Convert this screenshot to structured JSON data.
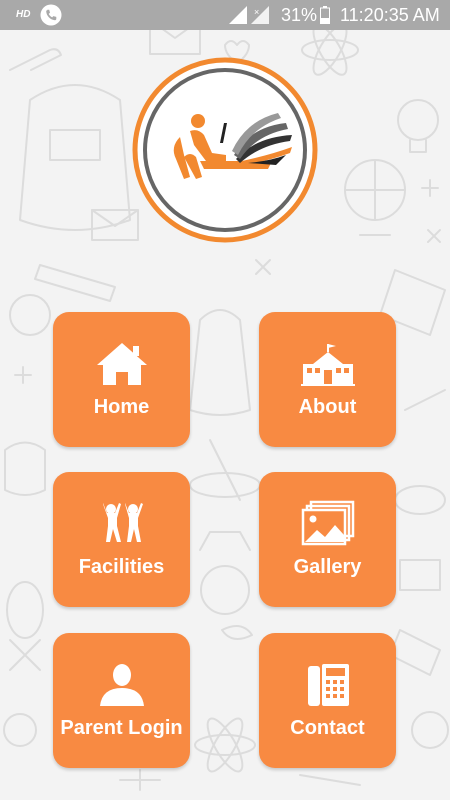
{
  "status_bar": {
    "hd": "HD",
    "battery": "31%",
    "time": "11:20:35 AM",
    "icons": [
      "phone-icon",
      "signal-icon",
      "battery-icon"
    ]
  },
  "logo": {
    "icon": "student-reading-logo"
  },
  "menu": {
    "home": {
      "label": "Home",
      "icon": "house-icon"
    },
    "about": {
      "label": "About",
      "icon": "school-building-icon"
    },
    "facilities": {
      "label": "Facilities",
      "icon": "children-icon"
    },
    "gallery": {
      "label": "Gallery",
      "icon": "photos-icon"
    },
    "parent_login": {
      "label": "Parent Login",
      "icon": "user-icon"
    },
    "contact": {
      "label": "Contact",
      "icon": "telephone-icon"
    }
  },
  "colors": {
    "accent": "#f88a42",
    "ring_inner": "#6b6b6b",
    "status_bar": "#a9a9a9"
  }
}
